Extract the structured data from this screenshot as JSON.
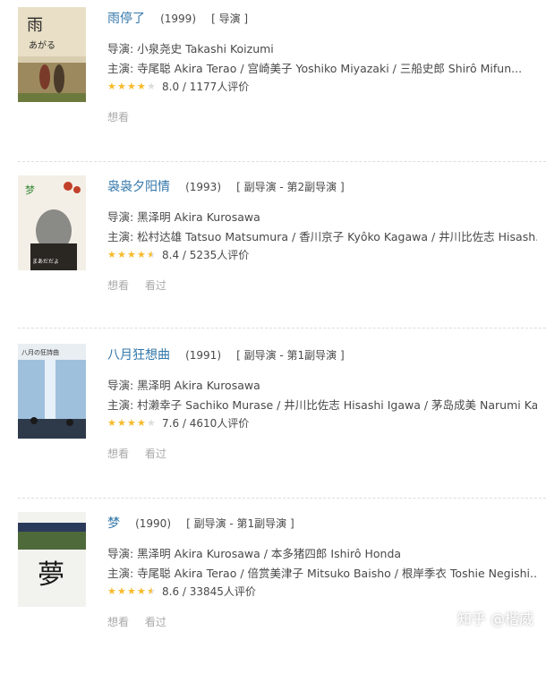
{
  "movies": [
    {
      "title": "雨停了",
      "year": "(1999)",
      "role": "[ 导演 ]",
      "director": "导演: 小泉尧史 Takashi Koizumi",
      "cast": "主演: 寺尾聪 Akira Terao / 宫崎美子 Yoshiko Miyazaki / 三船史郎 Shirô Mifun...",
      "stars": 4,
      "rating": "8.0 / 1177人评价",
      "actions": [
        "想看"
      ]
    },
    {
      "title": "袅袅夕阳情",
      "year": "(1993)",
      "role": "[ 副导演 - 第2副导演 ]",
      "director": "导演: 黑泽明 Akira Kurosawa",
      "cast": "主演: 松村达雄 Tatsuo Matsumura / 香川京子 Kyôko Kagawa / 井川比佐志 Hisash...",
      "stars": 4.5,
      "rating": "8.4 / 5235人评价",
      "actions": [
        "想看",
        "看过"
      ]
    },
    {
      "title": "八月狂想曲",
      "year": "(1991)",
      "role": "[ 副导演 - 第1副导演 ]",
      "director": "导演: 黑泽明 Akira Kurosawa",
      "cast": "主演: 村濑幸子 Sachiko Murase / 井川比佐志 Hisashi Igawa / 茅岛成美 Narumi Kay...",
      "stars": 4,
      "rating": "7.6 / 4610人评价",
      "actions": [
        "想看",
        "看过"
      ]
    },
    {
      "title": "梦",
      "year": "(1990)",
      "role": "[ 副导演 - 第1副导演 ]",
      "director": "导演: 黑泽明 Akira Kurosawa / 本多猪四郎 Ishirô Honda",
      "cast": "主演: 寺尾聪 Akira Terao / 倍赏美津子 Mitsuko Baisho / 根岸季衣 Toshie Negishi...",
      "stars": 4.5,
      "rating": "8.6 / 33845人评价",
      "actions": [
        "想看",
        "看过"
      ]
    }
  ],
  "watermark": "知乎 @楷威",
  "colors": {
    "link": "#3377aa",
    "star": "#f7ba2a",
    "muted": "#aaaaaa"
  }
}
